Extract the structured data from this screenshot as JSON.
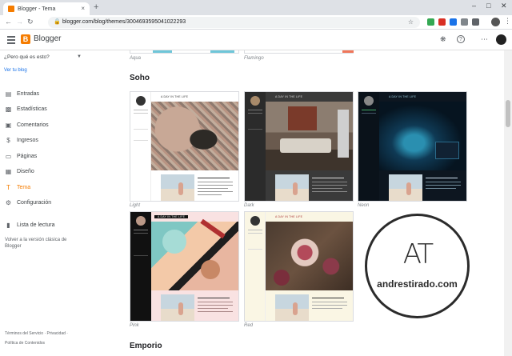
{
  "browser": {
    "tab_title": "Blogger - Tema",
    "tab_close": "×",
    "new_tab": "+",
    "url": "blogger.com/blog/themes/3004693595041022293"
  },
  "app": {
    "brand": "Blogger"
  },
  "sidebar": {
    "blog_selector": "¿Pero qué es esto?",
    "view_blog": "Ver tu blog",
    "items": [
      {
        "label": "Entradas",
        "icon": "posts-icon"
      },
      {
        "label": "Estadísticas",
        "icon": "stats-icon"
      },
      {
        "label": "Comentarios",
        "icon": "comments-icon"
      },
      {
        "label": "Ingresos",
        "icon": "earnings-icon"
      },
      {
        "label": "Páginas",
        "icon": "pages-icon"
      },
      {
        "label": "Diseño",
        "icon": "layout-icon"
      },
      {
        "label": "Tema",
        "icon": "theme-icon"
      },
      {
        "label": "Configuración",
        "icon": "settings-icon"
      },
      {
        "label": "Lista de lectura",
        "icon": "bookmark-icon"
      }
    ],
    "active_item": "Tema",
    "classic_link": "Volver a la versión clásica de Blogger",
    "terms": "Términos del Servicio",
    "privacy": "Privacidad",
    "content_policy": "Política de Contenidos"
  },
  "main": {
    "previous_captions": [
      "Aqua",
      "Flamingo"
    ],
    "section_soho": "Soho",
    "section_emporio": "Emporio",
    "soho_themes": [
      {
        "name": "Light",
        "blog_title": "A DAY IN THE LIFE"
      },
      {
        "name": "Dark",
        "blog_title": "A DAY IN THE LIFE"
      },
      {
        "name": "Neon",
        "blog_title": "A DAY IN THE LIFE"
      },
      {
        "name": "Pink",
        "blog_title": "A DAY IN THE LIFE"
      },
      {
        "name": "Red",
        "blog_title": "A DAY IN THE LIFE"
      }
    ]
  },
  "watermark": {
    "logo": "AT",
    "text": "andrestirado.com"
  },
  "colors": {
    "accent": "#f57c00",
    "link": "#1a73e8"
  }
}
